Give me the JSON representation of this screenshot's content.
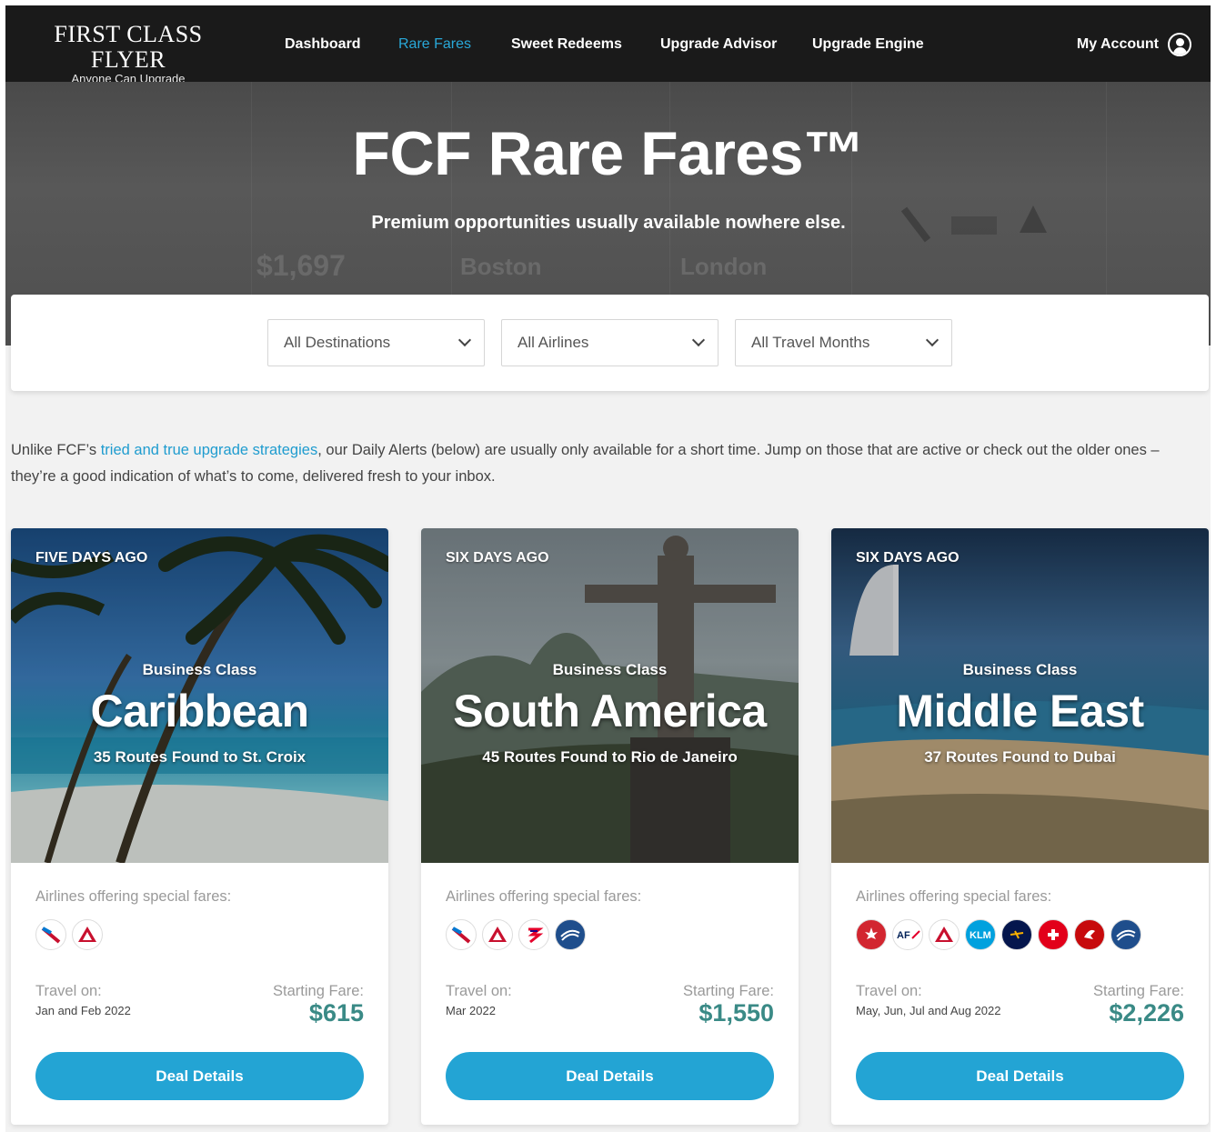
{
  "nav": {
    "logo_title": "FIRST CLASS FLYER",
    "logo_sub": "Anyone Can Upgrade",
    "links": [
      "Dashboard",
      "Rare Fares",
      "Sweet Redeems",
      "Upgrade Advisor",
      "Upgrade Engine"
    ],
    "active": "Rare Fares",
    "account": "My Account"
  },
  "hero": {
    "title": "FCF Rare Fares™",
    "subtitle": "Premium opportunities usually available nowhere else.",
    "bg_text": [
      "$1,697",
      "Boston",
      "London"
    ]
  },
  "filters": {
    "destinations": "All Destinations",
    "airlines": "All Airlines",
    "months": "All Travel Months"
  },
  "intro": {
    "before": "Unlike FCF’s ",
    "link": "tried and true upgrade strategies",
    "after": ", our Daily Alerts (below) are usually only available for a short time. Jump on those that are active or check out the older ones – they’re a good indication of what’s to come, delivered fresh to your inbox."
  },
  "cards": [
    {
      "age": "FIVE DAYS AGO",
      "class": "Business Class",
      "region": "Caribbean",
      "routes": "35 Routes Found to St. Croix",
      "airlines_label": "Airlines offering special fares:",
      "airlines": [
        "american-airlines",
        "delta"
      ],
      "travel_label": "Travel on:",
      "travel": "Jan and Feb 2022",
      "fare_label": "Starting Fare:",
      "fare": "$615",
      "button": "Deal Details"
    },
    {
      "age": "SIX DAYS AGO",
      "class": "Business Class",
      "region": "South America",
      "routes": "45 Routes Found to Rio de Janeiro",
      "airlines_label": "Airlines offering special fares:",
      "airlines": [
        "american-airlines",
        "delta",
        "latam",
        "united"
      ],
      "travel_label": "Travel on:",
      "travel": "Mar 2022",
      "fare_label": "Starting Fare:",
      "fare": "$1,550",
      "button": "Deal Details"
    },
    {
      "age": "SIX DAYS AGO",
      "class": "Business Class",
      "region": "Middle East",
      "routes": "37 Routes Found to Dubai",
      "airlines_label": "Airlines offering special fares:",
      "airlines": [
        "air-canada",
        "air-france",
        "delta",
        "klm",
        "lufthansa",
        "swiss",
        "turkish",
        "united"
      ],
      "travel_label": "Travel on:",
      "travel": "May, Jun, Jul and Aug 2022",
      "fare_label": "Starting Fare:",
      "fare": "$2,226",
      "button": "Deal Details"
    }
  ],
  "colors": {
    "nav_bg": "#1a1a1a",
    "accent": "#23a4d4",
    "fare": "#3a8a86"
  }
}
